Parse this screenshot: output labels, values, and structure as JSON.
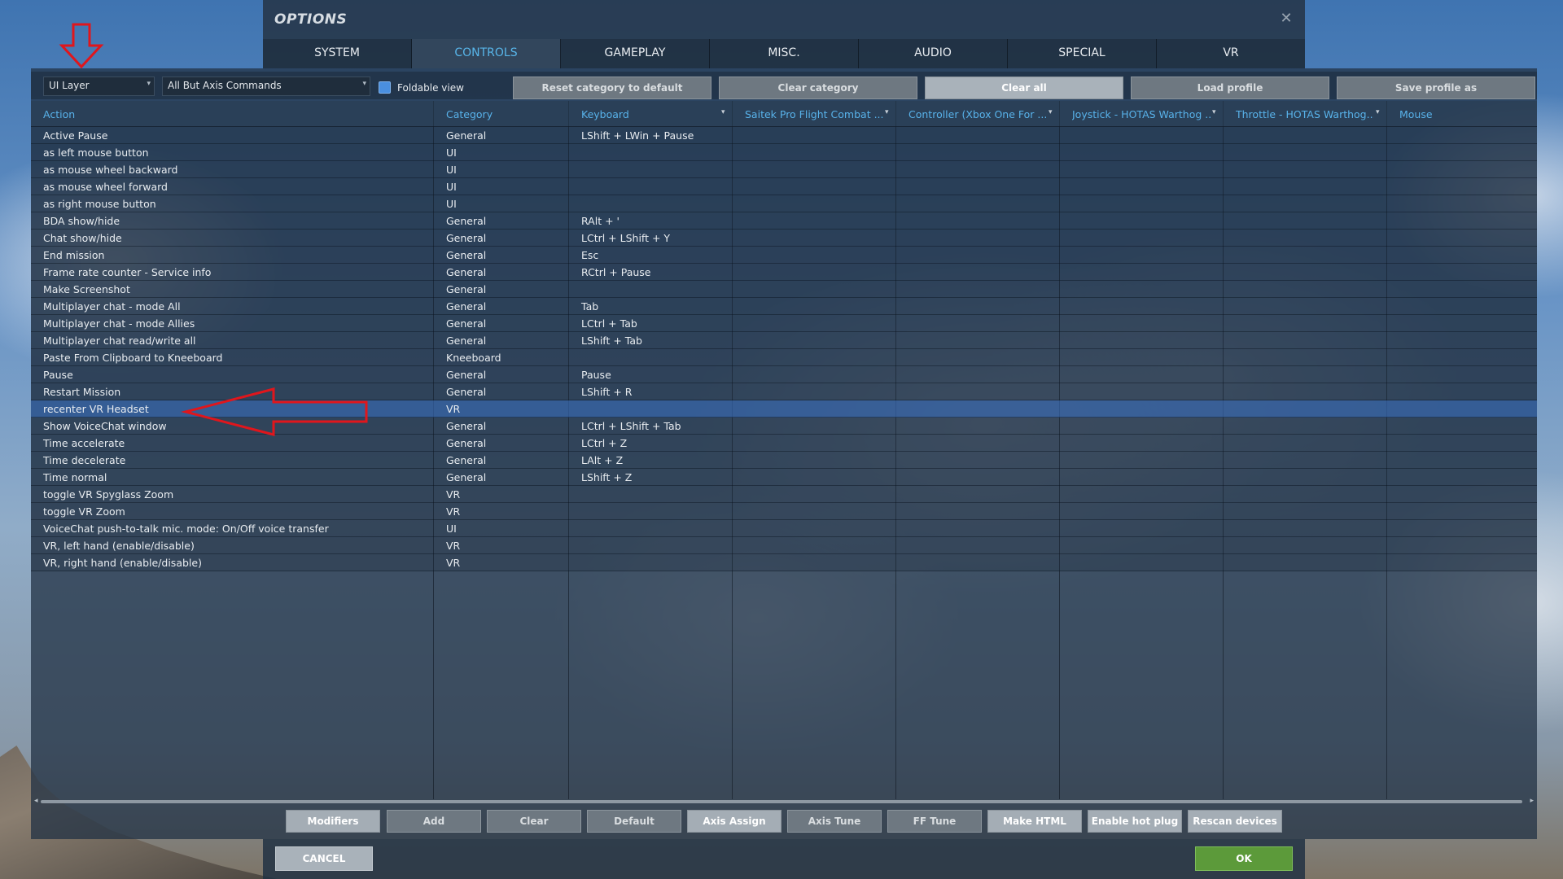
{
  "window": {
    "title": "OPTIONS",
    "close_glyph": "✕"
  },
  "tabs": [
    {
      "label": "SYSTEM",
      "active": false
    },
    {
      "label": "CONTROLS",
      "active": true
    },
    {
      "label": "GAMEPLAY",
      "active": false
    },
    {
      "label": "MISC.",
      "active": false
    },
    {
      "label": "AUDIO",
      "active": false
    },
    {
      "label": "SPECIAL",
      "active": false
    },
    {
      "label": "VR",
      "active": false
    }
  ],
  "toolbar": {
    "layer_select": "UI Layer",
    "filter_select": "All But Axis Commands",
    "foldable_label": "Foldable view",
    "foldable_checked": true,
    "buttons": [
      "Reset category to default",
      "Clear category",
      "Clear all",
      "Load profile",
      "Save profile as"
    ]
  },
  "columns": [
    "Action",
    "Category",
    "Keyboard",
    "Saitek Pro Flight Combat ...",
    "Controller (Xbox One For ...",
    "Joystick - HOTAS Warthog ...",
    "Throttle - HOTAS Warthog...",
    "Mouse"
  ],
  "rows": [
    {
      "action": "Active Pause",
      "category": "General",
      "keyboard": "LShift + LWin + Pause"
    },
    {
      "action": "as left mouse button",
      "category": "UI",
      "keyboard": ""
    },
    {
      "action": "as mouse wheel backward",
      "category": "UI",
      "keyboard": ""
    },
    {
      "action": "as mouse wheel forward",
      "category": "UI",
      "keyboard": ""
    },
    {
      "action": "as right mouse button",
      "category": "UI",
      "keyboard": ""
    },
    {
      "action": "BDA show/hide",
      "category": "General",
      "keyboard": "RAlt + '"
    },
    {
      "action": "Chat show/hide",
      "category": "General",
      "keyboard": "LCtrl + LShift + Y"
    },
    {
      "action": "End mission",
      "category": "General",
      "keyboard": "Esc"
    },
    {
      "action": "Frame rate counter - Service info",
      "category": "General",
      "keyboard": "RCtrl + Pause"
    },
    {
      "action": "Make Screenshot",
      "category": "General",
      "keyboard": ""
    },
    {
      "action": "Multiplayer chat - mode All",
      "category": "General",
      "keyboard": "Tab"
    },
    {
      "action": "Multiplayer chat - mode Allies",
      "category": "General",
      "keyboard": "LCtrl + Tab"
    },
    {
      "action": "Multiplayer chat read/write all",
      "category": "General",
      "keyboard": "LShift + Tab"
    },
    {
      "action": "Paste From Clipboard to Kneeboard",
      "category": "Kneeboard",
      "keyboard": ""
    },
    {
      "action": "Pause",
      "category": "General",
      "keyboard": "Pause"
    },
    {
      "action": "Restart Mission",
      "category": "General",
      "keyboard": "LShift + R"
    },
    {
      "action": "recenter VR Headset",
      "category": "VR",
      "keyboard": "",
      "selected": true
    },
    {
      "action": "Show VoiceChat window",
      "category": "General",
      "keyboard": "LCtrl + LShift + Tab"
    },
    {
      "action": "Time accelerate",
      "category": "General",
      "keyboard": "LCtrl + Z"
    },
    {
      "action": "Time decelerate",
      "category": "General",
      "keyboard": "LAlt + Z"
    },
    {
      "action": "Time normal",
      "category": "General",
      "keyboard": "LShift + Z"
    },
    {
      "action": "toggle VR Spyglass Zoom",
      "category": "VR",
      "keyboard": ""
    },
    {
      "action": "toggle VR Zoom",
      "category": "VR",
      "keyboard": ""
    },
    {
      "action": "VoiceChat push-to-talk mic. mode: On/Off voice transfer",
      "category": "UI",
      "keyboard": ""
    },
    {
      "action": "VR, left hand (enable/disable)",
      "category": "VR",
      "keyboard": ""
    },
    {
      "action": "VR, right hand (enable/disable)",
      "category": "VR",
      "keyboard": ""
    }
  ],
  "bottom_buttons": [
    "Modifiers",
    "Add",
    "Clear",
    "Default",
    "Axis Assign",
    "Axis Tune",
    "FF Tune",
    "Make HTML",
    "Enable hot plug",
    "Rescan devices"
  ],
  "footer": {
    "cancel": "CANCEL",
    "ok": "OK"
  },
  "icons": {
    "dropdown": "dropdown-arrow-icon",
    "close": "close-icon",
    "annotation": "red-arrow-annotation"
  },
  "colors": {
    "accent_blue": "#58b2ea",
    "selected_row": "#3464aa",
    "ok_green": "#5c9a3a",
    "annotation_red": "#e0161c"
  }
}
